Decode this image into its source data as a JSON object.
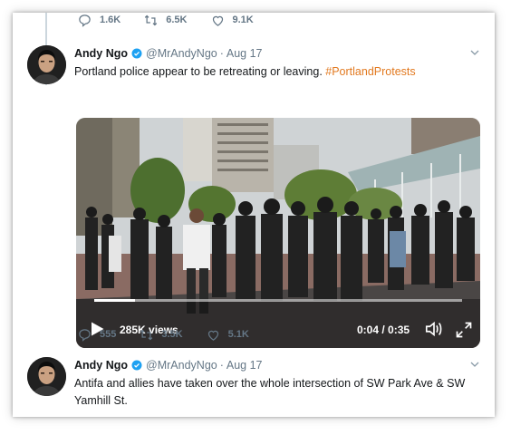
{
  "top_actions": {
    "reply": "1.6K",
    "retweet": "6.5K",
    "like": "9.1K"
  },
  "tweet1": {
    "name": "Andy Ngo",
    "handle": "@MrAndyNgo",
    "sep": "·",
    "date": "Aug 17",
    "text": "Portland police appear to be retreating or leaving. ",
    "hashtag": "#PortlandProtests",
    "video": {
      "views": "285K views",
      "time": "0:04 / 0:35",
      "progress": 0.11
    },
    "actions": {
      "reply": "555",
      "retweet": "3.5K",
      "like": "5.1K"
    }
  },
  "tweet2": {
    "name": "Andy Ngo",
    "handle": "@MrAndyNgo",
    "sep": "·",
    "date": "Aug 17",
    "text": "Antifa and allies have taken over the whole intersection of SW Park Ave & SW Yamhill St."
  },
  "colors": {
    "accent": "#1da1f2",
    "hashtag": "#e2791f",
    "muted": "#657786"
  }
}
